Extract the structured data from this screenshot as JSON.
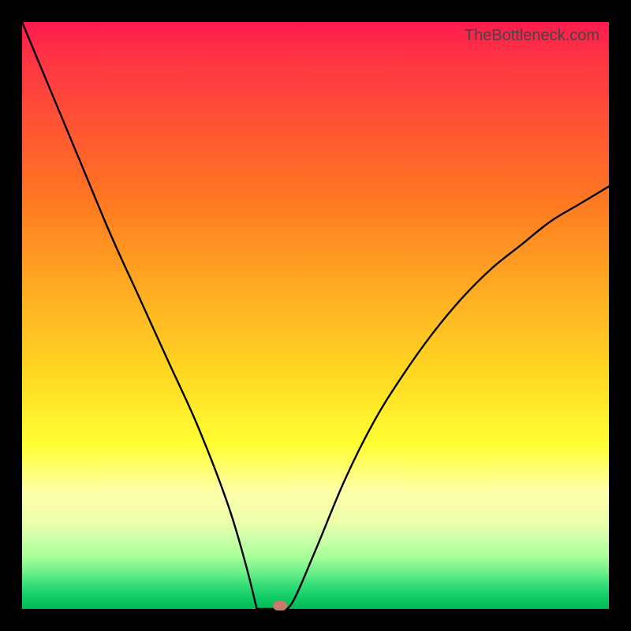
{
  "watermark": "TheBottleneck.com",
  "chart_data": {
    "type": "line",
    "title": "",
    "xlabel": "",
    "ylabel": "",
    "xlim": [
      0,
      100
    ],
    "ylim": [
      0,
      100
    ],
    "grid": false,
    "legend": false,
    "series": [
      {
        "name": "bottleneck_curve",
        "x": [
          0,
          5,
          10,
          15,
          20,
          25,
          30,
          35,
          38,
          40,
          42,
          44,
          46,
          50,
          55,
          60,
          65,
          70,
          75,
          80,
          85,
          90,
          95,
          100
        ],
        "y": [
          100,
          88,
          76,
          64,
          53,
          42,
          31,
          18,
          8,
          1,
          0,
          0,
          1,
          10,
          22,
          32,
          40,
          47,
          53,
          58,
          62,
          66,
          69,
          72
        ]
      }
    ],
    "flat_bottom": {
      "x_start": 40,
      "x_end": 44,
      "y": 0
    },
    "marker": {
      "x": 44,
      "y": 0.5,
      "color": "#c97a6a"
    },
    "background_gradient": {
      "stops": [
        {
          "pos": 0.0,
          "color": "#ff1a4d"
        },
        {
          "pos": 0.18,
          "color": "#ff5533"
        },
        {
          "pos": 0.45,
          "color": "#ffaa22"
        },
        {
          "pos": 0.72,
          "color": "#ffff33"
        },
        {
          "pos": 0.85,
          "color": "#eeffaa"
        },
        {
          "pos": 1.0,
          "color": "#00bb55"
        }
      ]
    },
    "annotations": []
  }
}
